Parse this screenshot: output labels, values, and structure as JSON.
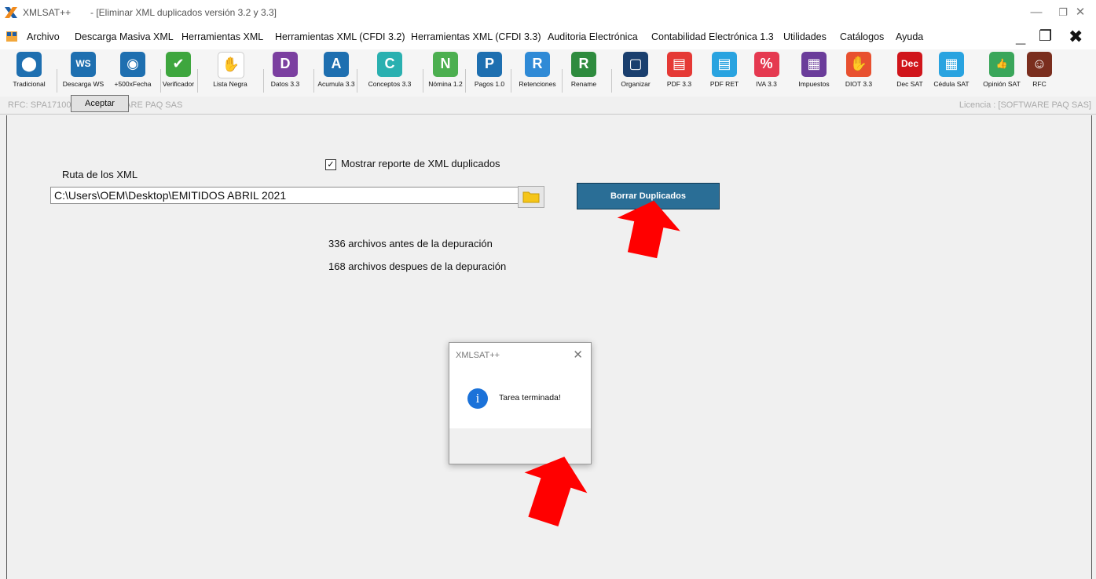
{
  "titlebar": {
    "app_name": "XMLSAT++",
    "document": "- [Eliminar XML duplicados versión 3.2 y 3.3]"
  },
  "menu": [
    "Archivo",
    "Descarga Masiva XML",
    "Herramientas XML",
    "Herramientas XML (CFDI 3.2)",
    "Herramientas XML (CFDI 3.3)",
    "Auditoria Electrónica",
    "Contabilidad Electrónica 1.3",
    "Utilidades",
    "Catálogos",
    "Ayuda"
  ],
  "toolbar": [
    {
      "label": "Tradicional",
      "glyph": "⬤",
      "color": "#1e6fb0"
    },
    {
      "label": "Descarga WS",
      "glyph": "WS",
      "color": "#1e6fb0"
    },
    {
      "label": "+500xFecha",
      "glyph": "◉",
      "color": "#1e6fb0"
    },
    {
      "label": "Verificador",
      "glyph": "✔",
      "color": "#3ea63e"
    },
    {
      "label": "Lista Negra",
      "glyph": "✋",
      "color": "#ffffff"
    },
    {
      "label": "Datos 3.3",
      "glyph": "D",
      "color": "#7b3fa0"
    },
    {
      "label": "Acumula 3.3",
      "glyph": "A",
      "color": "#1e6fb0"
    },
    {
      "label": "Conceptos 3.3",
      "glyph": "C",
      "color": "#2ab0b0"
    },
    {
      "label": "Nómina 1.2",
      "glyph": "N",
      "color": "#4caf50"
    },
    {
      "label": "Pagos 1.0",
      "glyph": "P",
      "color": "#1e6fb0"
    },
    {
      "label": "Retenciones",
      "glyph": "R",
      "color": "#2f8ad6"
    },
    {
      "label": "Rename",
      "glyph": "R",
      "color": "#2e8b3e"
    },
    {
      "label": "Organizar",
      "glyph": "▢",
      "color": "#1a3f6e"
    },
    {
      "label": "PDF 3.3",
      "glyph": "▤",
      "color": "#e53935"
    },
    {
      "label": "PDF RET",
      "glyph": "▤",
      "color": "#29a3e0"
    },
    {
      "label": "IVA 3.3",
      "glyph": "%",
      "color": "#e53950"
    },
    {
      "label": "Impuestos",
      "glyph": "▦",
      "color": "#6a3c9a"
    },
    {
      "label": "DIOT 3.3",
      "glyph": "✋",
      "color": "#e8502f"
    },
    {
      "label": "Dec SAT",
      "glyph": "Dec",
      "color": "#d0151b"
    },
    {
      "label": "Cédula SAT",
      "glyph": "▦",
      "color": "#29a3e0"
    },
    {
      "label": "Opinión SAT",
      "glyph": "👍",
      "color": "#3aa65a"
    },
    {
      "label": "RFC",
      "glyph": "☺",
      "color": "#7a2e1e"
    }
  ],
  "rfc_bar": {
    "rfc": "RFC: SPA1710063C9 SOFTWARE PAQ SAS",
    "license": "Licencia : [SOFTWARE PAQ SAS]"
  },
  "form": {
    "checkbox_label": "Mostrar reporte de XML duplicados",
    "path_label": "Ruta de los XML",
    "path_value": "C:\\Users\\OEM\\Desktop\\EMITIDOS ABRIL 2021",
    "action_button": "Borrar Duplicados",
    "before_text": "336 archivos antes de la depuración",
    "after_text": "168 archivos despues de la depuración"
  },
  "dialog": {
    "title": "XMLSAT++",
    "message": "Tarea terminada!",
    "ok_label": "Aceptar"
  },
  "colors": {
    "accent": "#2a6e96",
    "arrow": "#ff0000",
    "info_icon": "#1b72d9"
  }
}
